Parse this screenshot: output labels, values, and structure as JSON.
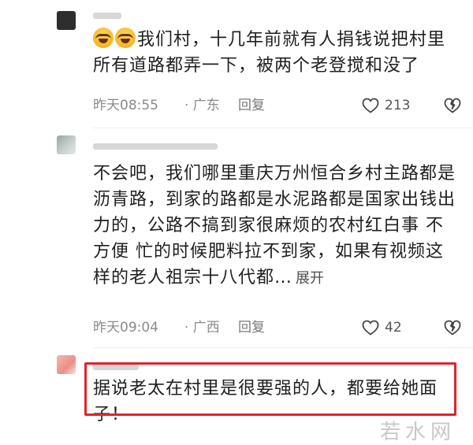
{
  "comments": [
    {
      "text": "我们村，十几年前就有人捐钱说把村里所有道路都弄一下，被两个老登搅和没了",
      "emoji_count": 2,
      "time": "昨天08:55",
      "region": "· 广东",
      "reply": "回复",
      "likes": "213"
    },
    {
      "text": "不会吧，我们哪里重庆万州恒合乡村主路都是沥青路，到家的路都是水泥路都是国家出钱出力的，公路不搞到家很麻烦的农村红白事 不方便 忙的时候肥料拉不到家，如果有视频这样的老人祖宗十八代都…",
      "expand": "展开",
      "time": "昨天09:04",
      "region": "· 广西",
      "reply": "回复",
      "likes": "42"
    },
    {
      "text": "据说老太在村里是很要强的人，都要给她面子！"
    }
  ],
  "watermark": "若水网",
  "colors": {
    "highlight_border": "#e2232a",
    "meta_text": "#8a8a8a"
  },
  "icons": [
    "like-heart-icon",
    "dislike-broken-heart-icon",
    "laugh-cry-emoji-icon"
  ]
}
